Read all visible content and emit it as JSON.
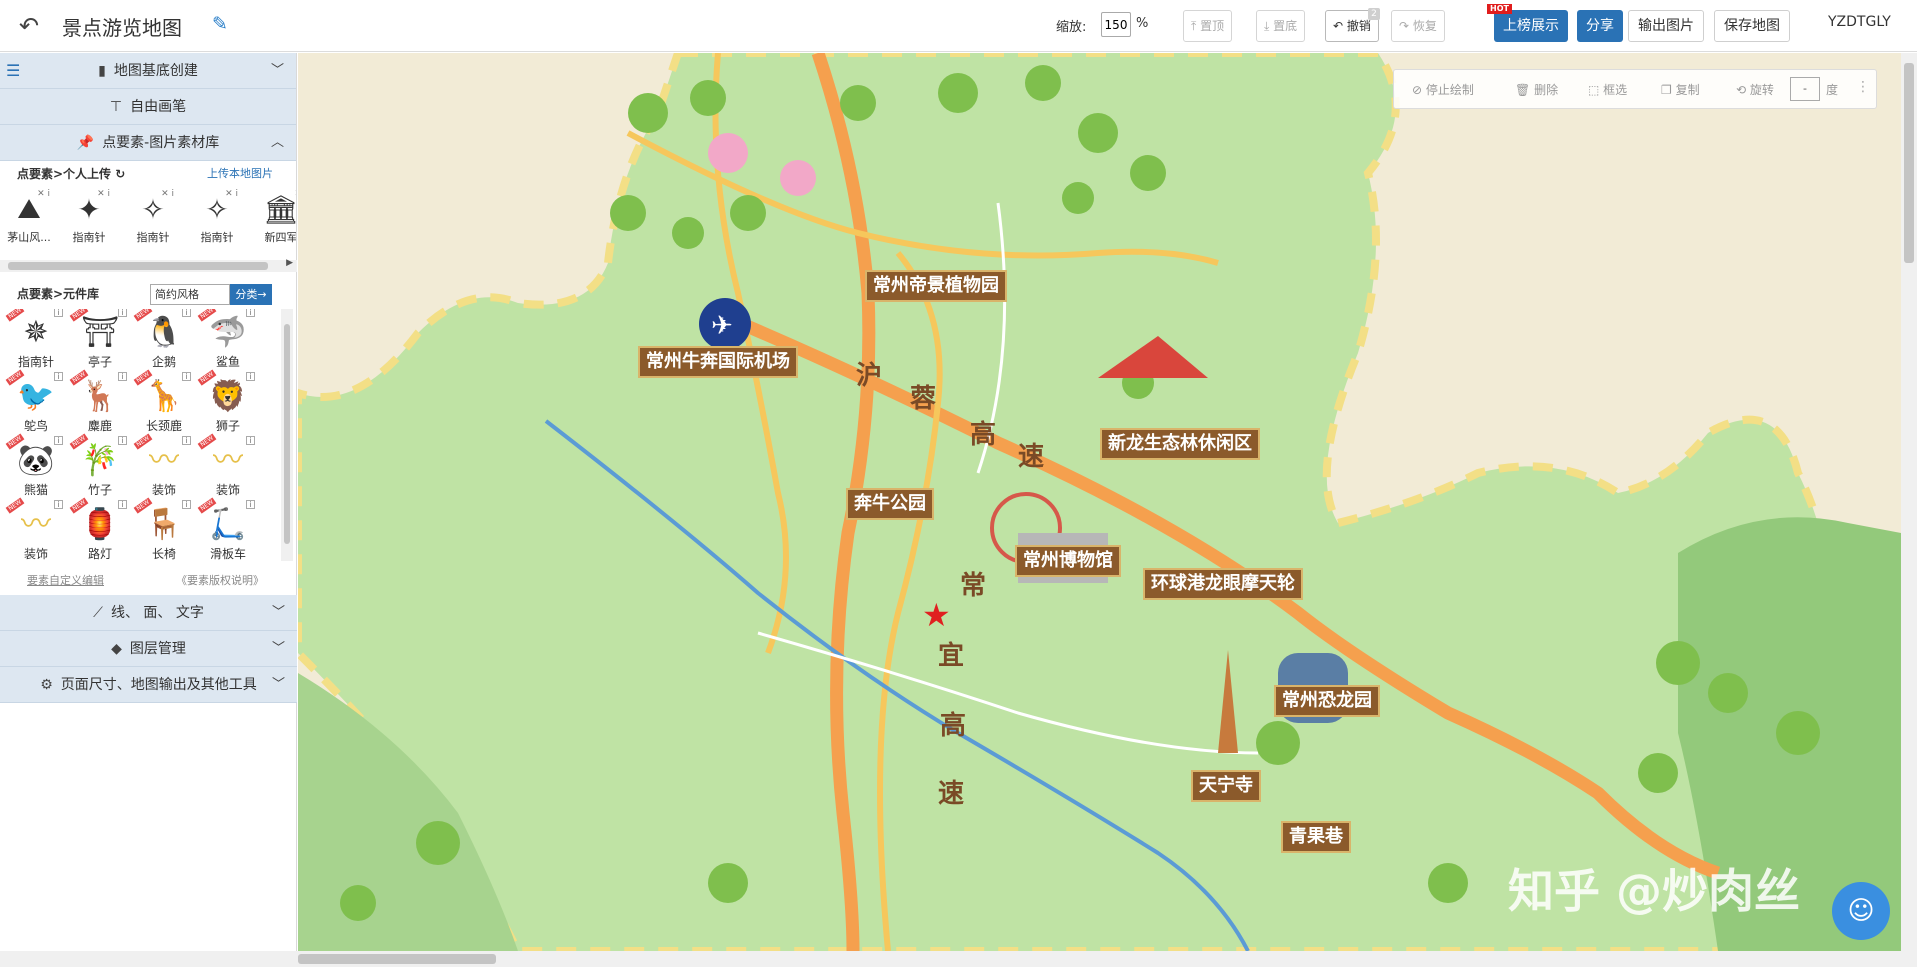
{
  "topbar": {
    "back_icon": "undo-arrow-icon",
    "title": "景点游览地图",
    "edit_icon": "edit-icon",
    "zoom_label": "缩放:",
    "zoom_value": "150",
    "zoom_unit": "%",
    "btn_top": "置顶",
    "btn_bottom": "置底",
    "btn_undo": "撤销",
    "undo_count": "2",
    "btn_redo": "恢复",
    "btn_rank": "上榜展示",
    "hot": "HOT",
    "btn_share": "分享",
    "btn_export": "输出图片",
    "btn_save": "保存地图",
    "user": "YZDTGLY"
  },
  "sidebar": {
    "sec_base": "地图基底创建",
    "sec_brush": "自由画笔",
    "sec_points": "点要素-图片素材库",
    "upload_head": "点要素>个人上传",
    "upload_link": "上传本地图片",
    "uploads": [
      {
        "label": "茅山风...",
        "icon": "mountain-icon"
      },
      {
        "label": "指南针",
        "icon": "compass-icon"
      },
      {
        "label": "指南针",
        "icon": "compass-icon"
      },
      {
        "label": "指南针",
        "icon": "compass-icon"
      },
      {
        "label": "新四军",
        "icon": "building-icon"
      }
    ],
    "lib_head": "点要素>元件库",
    "lib_style": "简约风格",
    "lib_btn": "分类→",
    "items": [
      {
        "label": "指南针",
        "glyph": "✵"
      },
      {
        "label": "亭子",
        "glyph": "⛩"
      },
      {
        "label": "企鹅",
        "glyph": "🐧"
      },
      {
        "label": "鲨鱼",
        "glyph": "🦈"
      },
      {
        "label": "鸵鸟",
        "glyph": "🐦"
      },
      {
        "label": "麋鹿",
        "glyph": "🦌"
      },
      {
        "label": "长颈鹿",
        "glyph": "🦒"
      },
      {
        "label": "狮子",
        "glyph": "🦁"
      },
      {
        "label": "熊猫",
        "glyph": "🐼"
      },
      {
        "label": "竹子",
        "glyph": "🎋"
      },
      {
        "label": "装饰",
        "glyph": "〰"
      },
      {
        "label": "装饰",
        "glyph": "〰"
      },
      {
        "label": "装饰",
        "glyph": "〰"
      },
      {
        "label": "路灯",
        "glyph": "🏮"
      },
      {
        "label": "长椅",
        "glyph": "🪑"
      },
      {
        "label": "滑板车",
        "glyph": "🛴"
      }
    ],
    "custom_link": "要素自定义编辑",
    "copyright_link": "《要素版权说明》",
    "sec_lines": "线、 面、 文字",
    "sec_layers": "图层管理",
    "sec_page": "页面尺寸、地图输出及其他工具"
  },
  "draw_tools": {
    "stop": "停止绘制",
    "delete": "删除",
    "select": "框选",
    "copy": "复制",
    "rotate": "旋转",
    "rotate_value": "-",
    "degree": "度"
  },
  "map": {
    "labels": [
      "常州帝景植物园",
      "常州牛奔国际机场",
      "新龙生态林休闲区",
      "奔牛公园",
      "常州博物馆",
      "环球港龙眼摩天轮",
      "常州恐龙园",
      "天宁寺",
      "青果巷"
    ],
    "road1": [
      "沪",
      "蓉",
      "高",
      "速"
    ],
    "road2": [
      "常",
      "宜",
      "高",
      "速"
    ],
    "watermark": "知乎 @炒肉丝"
  }
}
